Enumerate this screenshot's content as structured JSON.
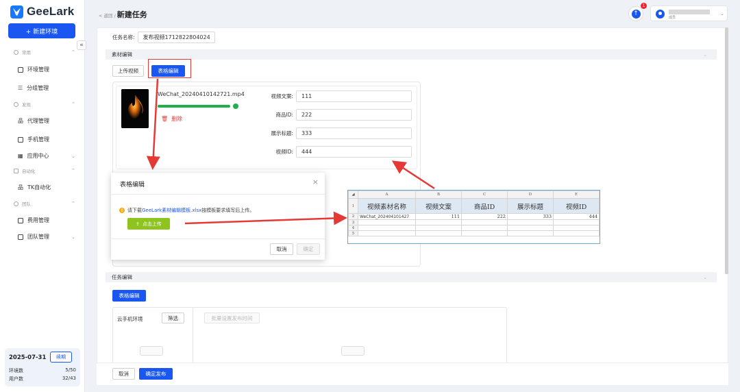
{
  "sidebar": {
    "logo": "GeeLark",
    "new_env_button": "+ 新建环境",
    "collapse": "«",
    "groups": [
      {
        "label": "常用",
        "icon": "home-icon",
        "items": [
          {
            "label": "环境管理",
            "icon": "window-icon"
          },
          {
            "label": "分组管理",
            "icon": "list-icon"
          }
        ]
      },
      {
        "label": "发现",
        "icon": "compass-icon",
        "items": [
          {
            "label": "代理管理",
            "icon": "network-icon"
          },
          {
            "label": "手机管理",
            "icon": "phone-icon"
          },
          {
            "label": "应用中心",
            "icon": "apps-icon"
          }
        ]
      },
      {
        "label": "自动化",
        "icon": "automation-icon",
        "items": [
          {
            "label": "TK自动化",
            "icon": "tree-icon"
          }
        ]
      },
      {
        "label": "团队",
        "icon": "team-icon",
        "items": [
          {
            "label": "费用管理",
            "icon": "bill-icon"
          },
          {
            "label": "团队管理",
            "icon": "team-manage-icon"
          }
        ]
      }
    ],
    "account": {
      "date": "2025-07-31",
      "renew": "续期",
      "env_label": "环境数",
      "env_value": "5/50",
      "user_label": "用户数",
      "user_value": "32/43"
    }
  },
  "header": {
    "back": "< 返回 /",
    "title": "新建任务",
    "badge": "1",
    "user_sub": "成员"
  },
  "form": {
    "task_name_label": "任务名称:",
    "task_name_value": "发布视频1712822804024",
    "material_section": "素材编辑",
    "upload_video": "上传视频",
    "table_edit": "表格编辑",
    "file_name": "WeChat_20240410142721.mp4",
    "progress": 1.0,
    "delete": "删除",
    "fields": [
      {
        "label": "视频文案:",
        "value": "111"
      },
      {
        "label": "商品ID:",
        "value": "222"
      },
      {
        "label": "展示标题:",
        "value": "333"
      },
      {
        "label": "视频ID:",
        "value": "444"
      }
    ],
    "task_section": "任务编辑",
    "task_table_edit": "表格编辑",
    "cloud_env": "云手机环境",
    "filter": "筛选",
    "batch_time": "批量设置发布时间",
    "cancel": "取消",
    "confirm_publish": "确定发布"
  },
  "modal": {
    "title": "表格编辑",
    "close": "×",
    "warn_prefix": "请下载",
    "warn_link": "GeeLark素材编辑模板.xlsx",
    "warn_suffix": "按模板要求填写后上传。",
    "upload_btn": "点击上传",
    "cancel": "取消",
    "confirm": "确定"
  },
  "sheet": {
    "corner": "◢",
    "columns": [
      "A",
      "B",
      "C",
      "D",
      "E"
    ],
    "headers": [
      "视频素材名称",
      "视频文案",
      "商品ID",
      "展示标题",
      "视频ID"
    ],
    "rows": [
      {
        "n": "1"
      },
      {
        "n": "2",
        "cells": [
          "WeChat_202404101427",
          "111",
          "222",
          "333",
          "444"
        ]
      },
      {
        "n": "3"
      },
      {
        "n": "4"
      },
      {
        "n": "5"
      }
    ]
  },
  "colors": {
    "primary": "#1a56f0",
    "success": "#20b04b",
    "danger": "#e53935",
    "upload_green": "#8fc31f",
    "warning": "#faad14"
  }
}
